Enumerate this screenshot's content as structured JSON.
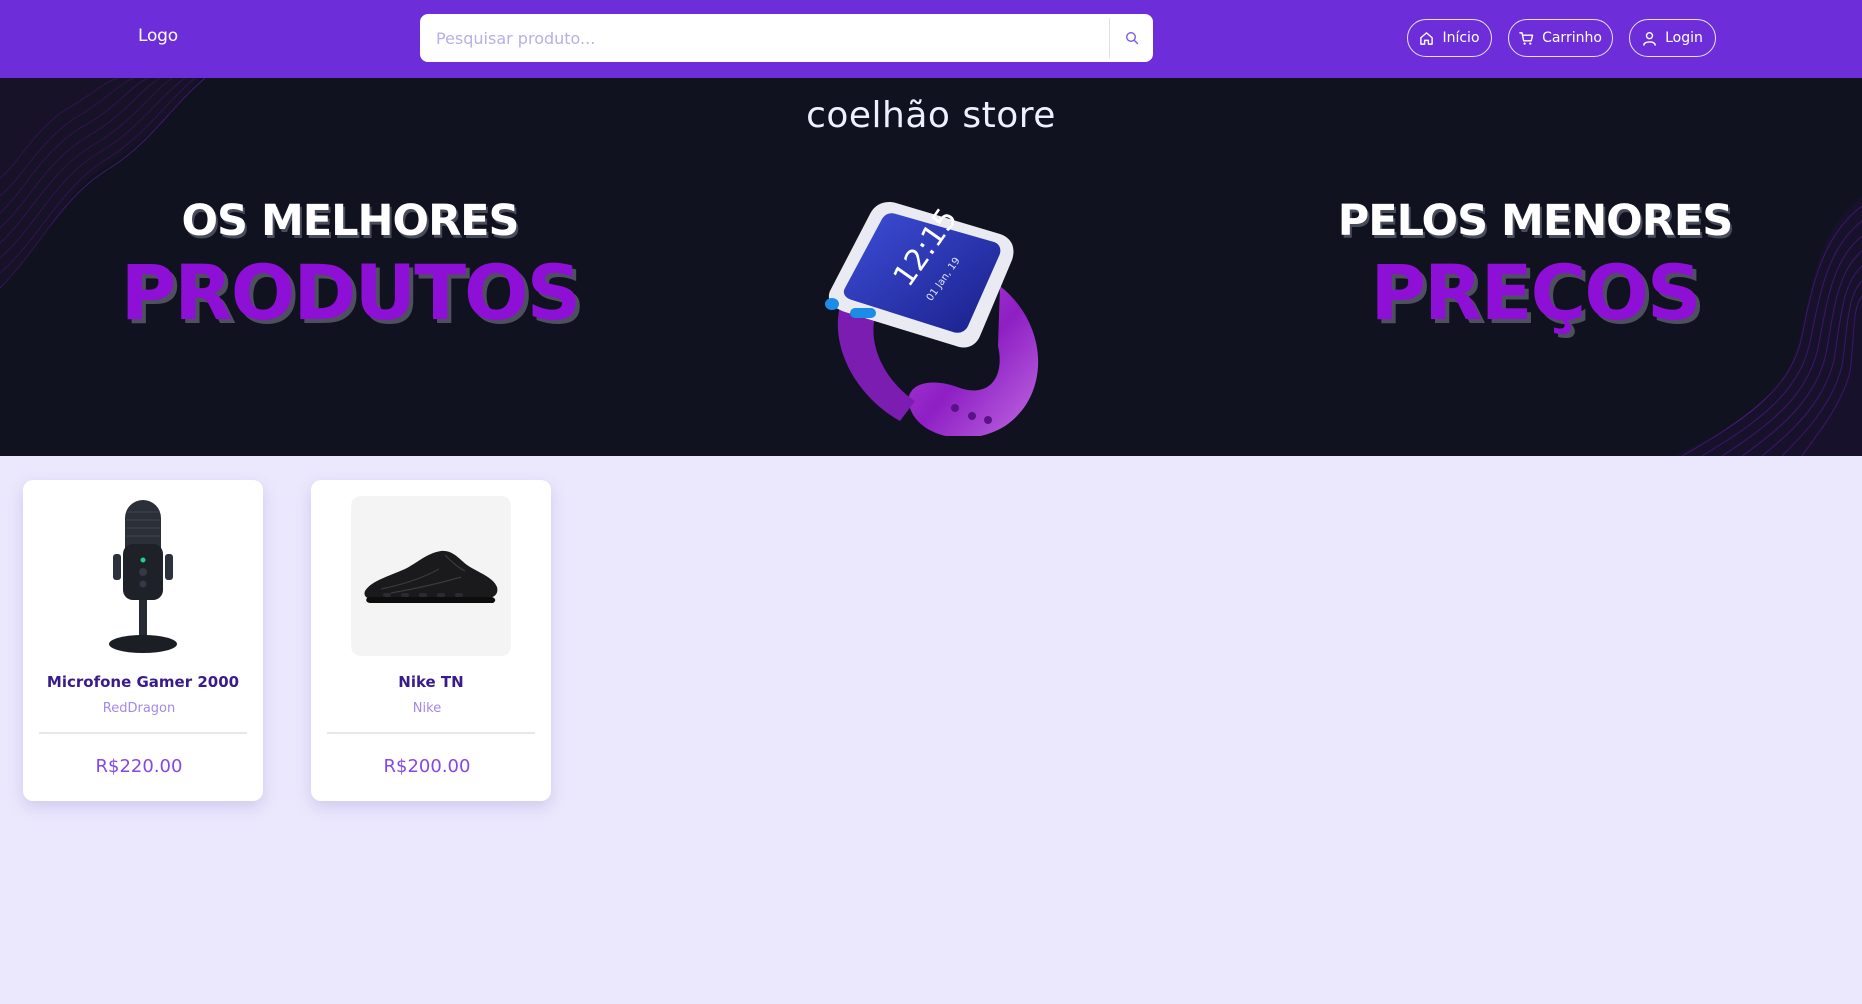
{
  "header": {
    "logo": "Logo",
    "search": {
      "placeholder": "Pesquisar produto...",
      "value": ""
    },
    "nav": [
      {
        "label": "Início",
        "icon": "home-icon"
      },
      {
        "label": "Carrinho",
        "icon": "cart-icon"
      },
      {
        "label": "Login",
        "icon": "user-icon"
      }
    ]
  },
  "banner": {
    "store_name": "coelhão store",
    "left_small": "OS MELHORES",
    "left_big": "PRODUTOS",
    "right_small": "PELOS MENORES",
    "right_big": "PREÇOS",
    "watch_time": "12:15",
    "watch_date": "01 Jan, 19"
  },
  "products": [
    {
      "name": "Microfone Gamer 2000",
      "brand": "RedDragon",
      "price": "R$220.00",
      "image": "microphone-image"
    },
    {
      "name": "Nike TN",
      "brand": "Nike",
      "price": "R$200.00",
      "image": "sneaker-image"
    }
  ],
  "colors": {
    "header_bg": "#6d2ed9",
    "banner_bg": "#10121f",
    "page_bg": "#ebe8fd",
    "accent_purple": "#8e0fd6",
    "price": "#8548e6"
  }
}
